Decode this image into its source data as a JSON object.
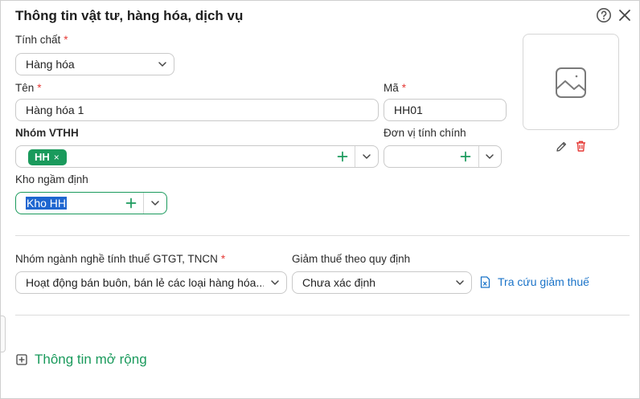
{
  "dialog": {
    "title": "Thông tin vật tư, hàng hóa, dịch vụ",
    "help_icon": "question-circle-icon",
    "close_icon": "close-icon"
  },
  "colors": {
    "accent_green": "#1a9a5c",
    "required_red": "#e53935",
    "link_blue": "#1a73c8",
    "selection_blue": "#1e66d0"
  },
  "form": {
    "tinh_chat": {
      "label": "Tính chất",
      "required": "*",
      "value": "Hàng hóa"
    },
    "ten": {
      "label": "Tên",
      "required": "*",
      "value": "Hàng hóa 1"
    },
    "ma": {
      "label": "Mã",
      "required": "*",
      "value": "HH01"
    },
    "nhom_vthh": {
      "label": "Nhóm VTHH",
      "tags": [
        "HH"
      ],
      "tag_remove": "×"
    },
    "don_vi_tinh": {
      "label": "Đơn vị tính chính",
      "value": ""
    },
    "kho": {
      "label": "Kho ngầm định",
      "value": "Kho HH"
    },
    "nhom_nganh": {
      "label": "Nhóm ngành nghề tính thuế GTGT, TNCN",
      "required": "*",
      "value": "Hoạt động bán buôn, bán lẻ các loại hàng hóa..."
    },
    "giam_thue": {
      "label": "Giảm thuế theo quy định",
      "value": "Chưa xác định"
    },
    "tra_cuu_link": "Tra cứu giảm thuế"
  },
  "image": {
    "placeholder_icon": "image-icon",
    "edit_icon": "pencil-icon",
    "delete_icon": "trash-icon"
  },
  "expand_section": {
    "label": "Thông tin mở rộng",
    "icon": "plus-square-icon"
  }
}
